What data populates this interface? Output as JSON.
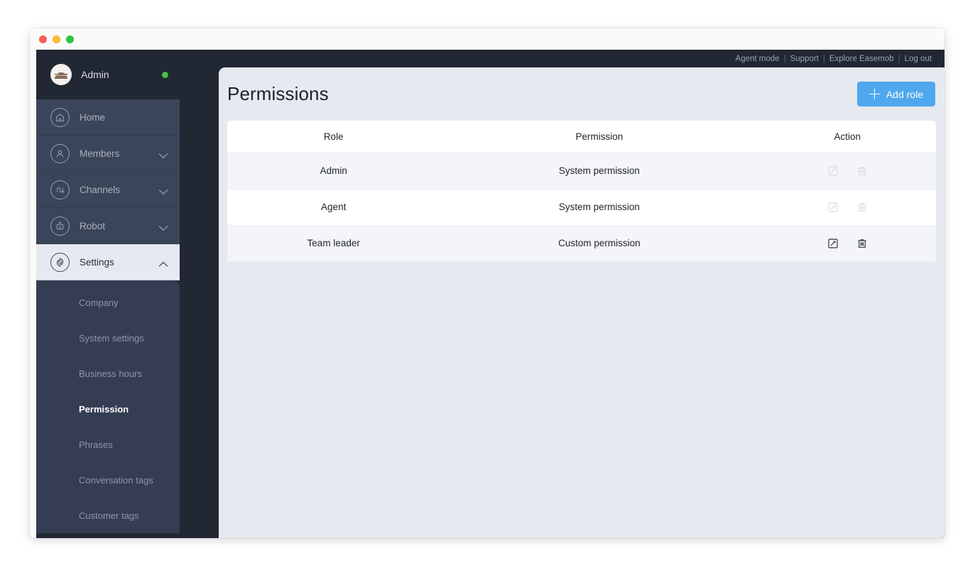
{
  "window": {
    "traffic_lights": [
      "close",
      "minimize",
      "maximize"
    ]
  },
  "sidebar": {
    "profile": {
      "name": "Admin",
      "avatar_icon": "user-avatar",
      "status_icon": "online-status-dot"
    },
    "items": [
      {
        "label": "Home",
        "icon": "home-icon",
        "expandable": false,
        "active": false
      },
      {
        "label": "Members",
        "icon": "members-icon",
        "expandable": true,
        "active": false
      },
      {
        "label": "Channels",
        "icon": "channels-icon",
        "expandable": true,
        "active": false
      },
      {
        "label": "Robot",
        "icon": "robot-icon",
        "expandable": true,
        "active": false
      },
      {
        "label": "Settings",
        "icon": "gear-icon",
        "expandable": true,
        "active": true
      }
    ],
    "submenu": [
      {
        "label": "Company",
        "active": false
      },
      {
        "label": "System settings",
        "active": false
      },
      {
        "label": "Business hours",
        "active": false
      },
      {
        "label": "Permission",
        "active": true
      },
      {
        "label": "Phrases",
        "active": false
      },
      {
        "label": "Conversation tags",
        "active": false
      },
      {
        "label": "Customer tags",
        "active": false
      }
    ]
  },
  "topbar": {
    "links": [
      "Agent mode",
      "Support",
      "Explore Easemob",
      "Log out"
    ],
    "separator": "|"
  },
  "page": {
    "title": "Permissions",
    "add_button": {
      "label": "Add role",
      "icon": "plus-icon",
      "color": "#4fa8ed"
    }
  },
  "table": {
    "columns": [
      "Role",
      "Permission",
      "Action"
    ],
    "rows": [
      {
        "role": "Admin",
        "permission": "System permission",
        "edit_icon": "edit-icon",
        "delete_icon": "trash-icon",
        "actions_enabled": false
      },
      {
        "role": "Agent",
        "permission": "System permission",
        "edit_icon": "edit-icon",
        "delete_icon": "trash-icon",
        "actions_enabled": false
      },
      {
        "role": "Team leader",
        "permission": "Custom permission",
        "edit_icon": "edit-icon",
        "delete_icon": "trash-icon",
        "actions_enabled": true
      }
    ]
  },
  "colors": {
    "sidebar_dark": "#212733",
    "sidebar_item": "#3b4559",
    "submenu": "#343d52",
    "content_bg": "#e6e9f0",
    "row_stripe": "#f4f5f9",
    "accent": "#4fa8ed",
    "status_online": "#44c445"
  }
}
